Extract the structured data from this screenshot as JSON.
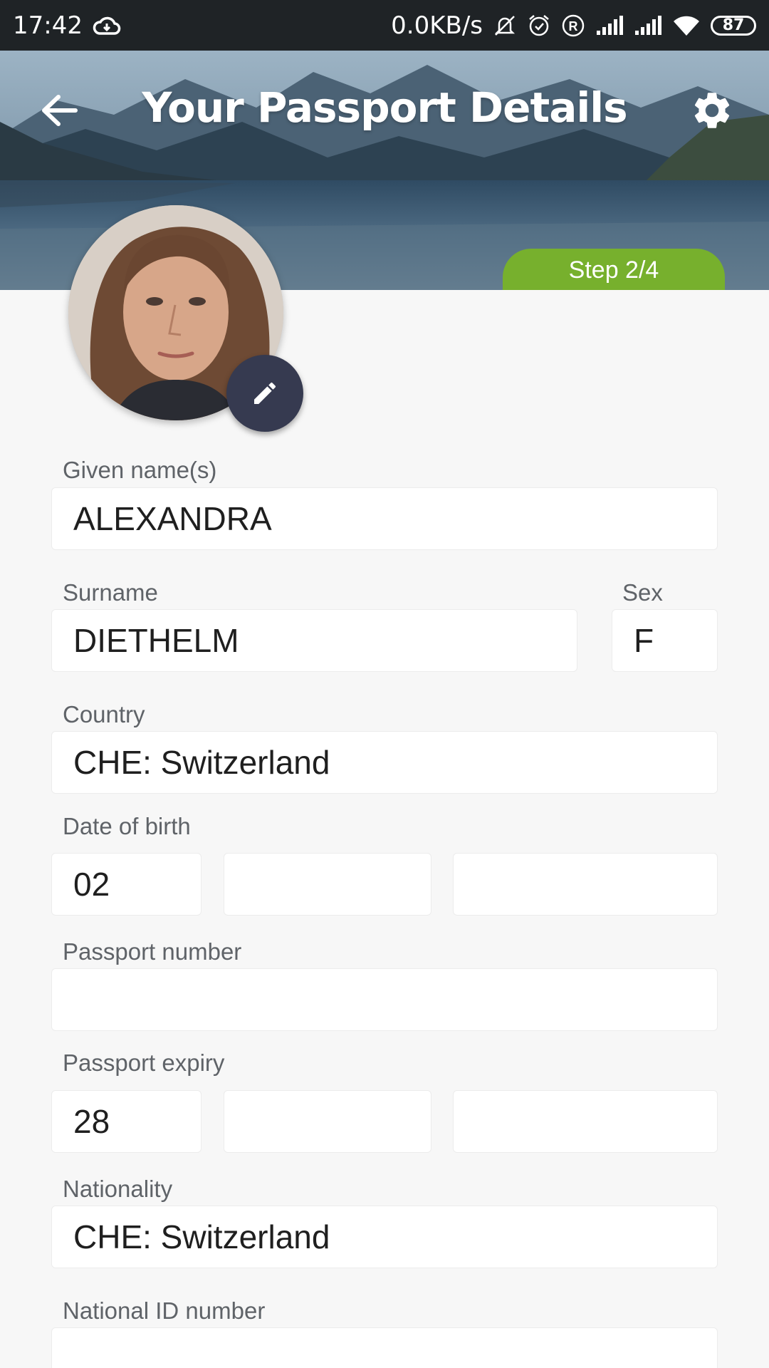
{
  "status_bar": {
    "time": "17:42",
    "network_speed": "0.0KB/s",
    "battery": "87",
    "icons": [
      "cloud-icon",
      "mute-icon",
      "alarm-icon",
      "registered-icon",
      "signal-icon",
      "signal-icon",
      "wifi-icon",
      "battery-icon"
    ]
  },
  "header": {
    "title": "Your Passport Details",
    "step": "Step 2/4",
    "back_icon": "arrow-back-icon",
    "settings_icon": "gear-icon"
  },
  "avatar": {
    "edit_icon": "pencil-icon"
  },
  "form": {
    "given_names": {
      "label": "Given name(s)",
      "value": "ALEXANDRA"
    },
    "surname": {
      "label": "Surname",
      "value": "DIETHELM"
    },
    "sex": {
      "label": "Sex",
      "value": "F"
    },
    "country": {
      "label": "Country",
      "value": "CHE: Switzerland"
    },
    "date_of_birth": {
      "label": "Date of birth",
      "day": "02",
      "month": "",
      "year": ""
    },
    "passport_number": {
      "label": "Passport number",
      "value": ""
    },
    "passport_expiry": {
      "label": "Passport expiry",
      "day": "28",
      "month": "",
      "year": ""
    },
    "nationality": {
      "label": "Nationality",
      "value": "CHE: Switzerland"
    },
    "national_id": {
      "label": "National ID number",
      "value": ""
    }
  },
  "colors": {
    "status_bar": "#1f2326",
    "step_badge": "#77b02d",
    "edit_button": "#363a50",
    "background": "#f7f7f7"
  }
}
